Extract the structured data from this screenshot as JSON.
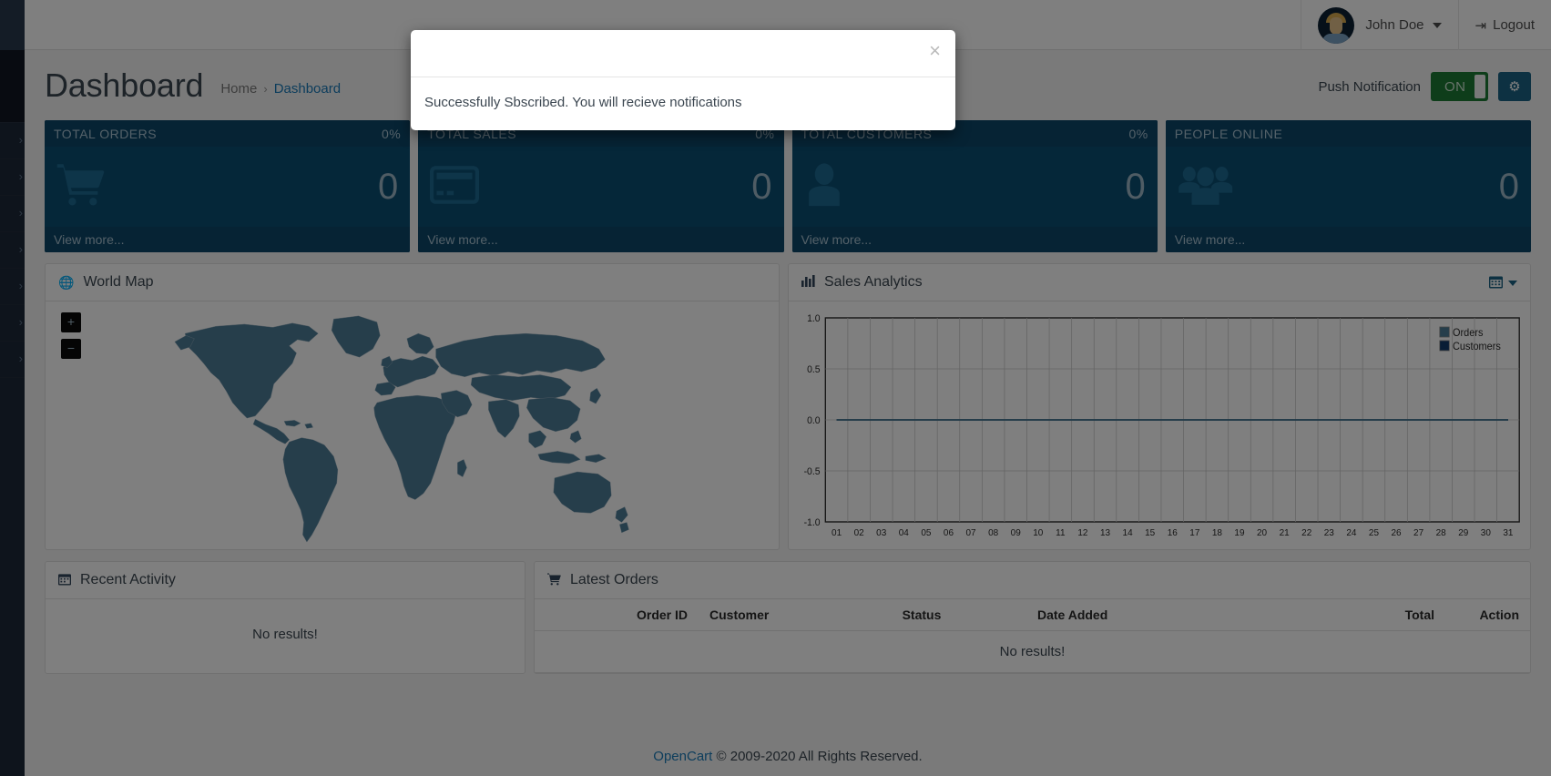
{
  "topbar": {
    "user_name": "John Doe",
    "user_caret_icon": "chevron-down-icon",
    "logout_label": "Logout",
    "logout_icon": "sign-out-icon",
    "avatar_icon": "user-avatar"
  },
  "sidebar": {
    "collapsed": true,
    "item_count": 7,
    "chevron_icon": "chevron-right-icon"
  },
  "page": {
    "title": "Dashboard",
    "breadcrumb": [
      {
        "label": "Home",
        "active": false
      },
      {
        "label": "Dashboard",
        "active": true
      }
    ],
    "breadcrumb_separator": "›"
  },
  "push_notification": {
    "label": "Push Notification",
    "toggle_state": "ON",
    "toggle_color": "#1d7a35",
    "settings_icon": "gear-icon",
    "settings_color": "#1a6384"
  },
  "tiles": [
    {
      "title": "TOTAL ORDERS",
      "percent": "0%",
      "value": "0",
      "icon": "shopping-cart-icon",
      "link": "View more..."
    },
    {
      "title": "TOTAL SALES",
      "percent": "0%",
      "value": "0",
      "icon": "credit-card-icon",
      "link": "View more..."
    },
    {
      "title": "TOTAL CUSTOMERS",
      "percent": "0%",
      "value": "0",
      "icon": "user-icon",
      "link": "View more..."
    },
    {
      "title": "PEOPLE ONLINE",
      "percent": "",
      "value": "0",
      "icon": "users-group-icon",
      "link": "View more..."
    }
  ],
  "map_panel": {
    "title": "World Map",
    "icon": "globe-icon",
    "zoom_in_label": "+",
    "zoom_out_label": "−",
    "region_color": "#4c7c97"
  },
  "chart_panel": {
    "title": "Sales Analytics",
    "icon": "bar-chart-icon",
    "calendar_icon": "calendar-icon",
    "caret_icon": "chevron-down-icon"
  },
  "chart_data": {
    "type": "line",
    "title": "Sales Analytics",
    "xlabel": "",
    "ylabel": "",
    "x": [
      "01",
      "02",
      "03",
      "04",
      "05",
      "06",
      "07",
      "08",
      "09",
      "10",
      "11",
      "12",
      "13",
      "14",
      "15",
      "16",
      "17",
      "18",
      "19",
      "20",
      "21",
      "22",
      "23",
      "24",
      "25",
      "26",
      "27",
      "28",
      "29",
      "30",
      "31"
    ],
    "yticks": [
      "-1.0",
      "-0.5",
      "0.0",
      "0.5",
      "1.0"
    ],
    "ylim": [
      -1.0,
      1.0
    ],
    "grid": true,
    "legend_position": "top-right",
    "series": [
      {
        "name": "Orders",
        "color": "#4c7c97",
        "values": [
          0,
          0,
          0,
          0,
          0,
          0,
          0,
          0,
          0,
          0,
          0,
          0,
          0,
          0,
          0,
          0,
          0,
          0,
          0,
          0,
          0,
          0,
          0,
          0,
          0,
          0,
          0,
          0,
          0,
          0,
          0
        ]
      },
      {
        "name": "Customers",
        "color": "#123a6b",
        "values": [
          0,
          0,
          0,
          0,
          0,
          0,
          0,
          0,
          0,
          0,
          0,
          0,
          0,
          0,
          0,
          0,
          0,
          0,
          0,
          0,
          0,
          0,
          0,
          0,
          0,
          0,
          0,
          0,
          0,
          0,
          0
        ]
      }
    ]
  },
  "activity_panel": {
    "title": "Recent Activity",
    "icon": "calendar-icon",
    "empty_text": "No results!"
  },
  "orders_panel": {
    "title": "Latest Orders",
    "icon": "shopping-cart-icon",
    "columns": [
      "Order ID",
      "Customer",
      "Status",
      "Date Added",
      "Total",
      "Action"
    ],
    "empty_text": "No results!"
  },
  "footer": {
    "brand": "OpenCart",
    "copyright": "© 2009-2020 All Rights Reserved."
  },
  "modal": {
    "message": "Successfully Sbscribed. You will recieve notifications",
    "close_label": "×"
  }
}
